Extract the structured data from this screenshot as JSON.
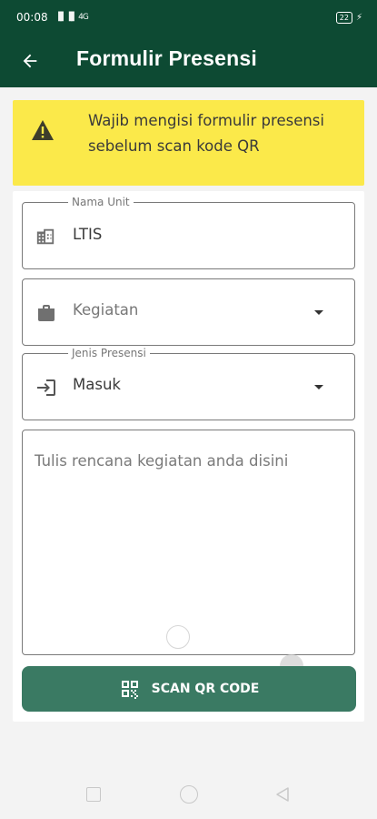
{
  "status_bar": {
    "time": "00:08",
    "signal": "▐▌▐▌ 4G",
    "battery": "22"
  },
  "app_bar": {
    "title": "Formulir Presensi"
  },
  "warning": {
    "text": "Wajib mengisi formulir presensi sebelum scan kode QR",
    "color": "#fbe94a"
  },
  "form": {
    "unit": {
      "label": "Nama Unit",
      "value": "LTIS",
      "icon": "building-icon"
    },
    "activity": {
      "placeholder": "Kegiatan",
      "icon": "briefcase-icon"
    },
    "attendance_type": {
      "label": "Jenis Presensi",
      "value": "Masuk",
      "icon": "login-icon"
    },
    "notes": {
      "placeholder": "Tulis rencana kegiatan anda disini"
    },
    "scan_button": {
      "label": "SCAN QR CODE",
      "icon": "qr-code-icon"
    }
  },
  "colors": {
    "primary_dark": "#0d4a33",
    "button": "#3a7a63",
    "banner": "#fbe94a"
  }
}
